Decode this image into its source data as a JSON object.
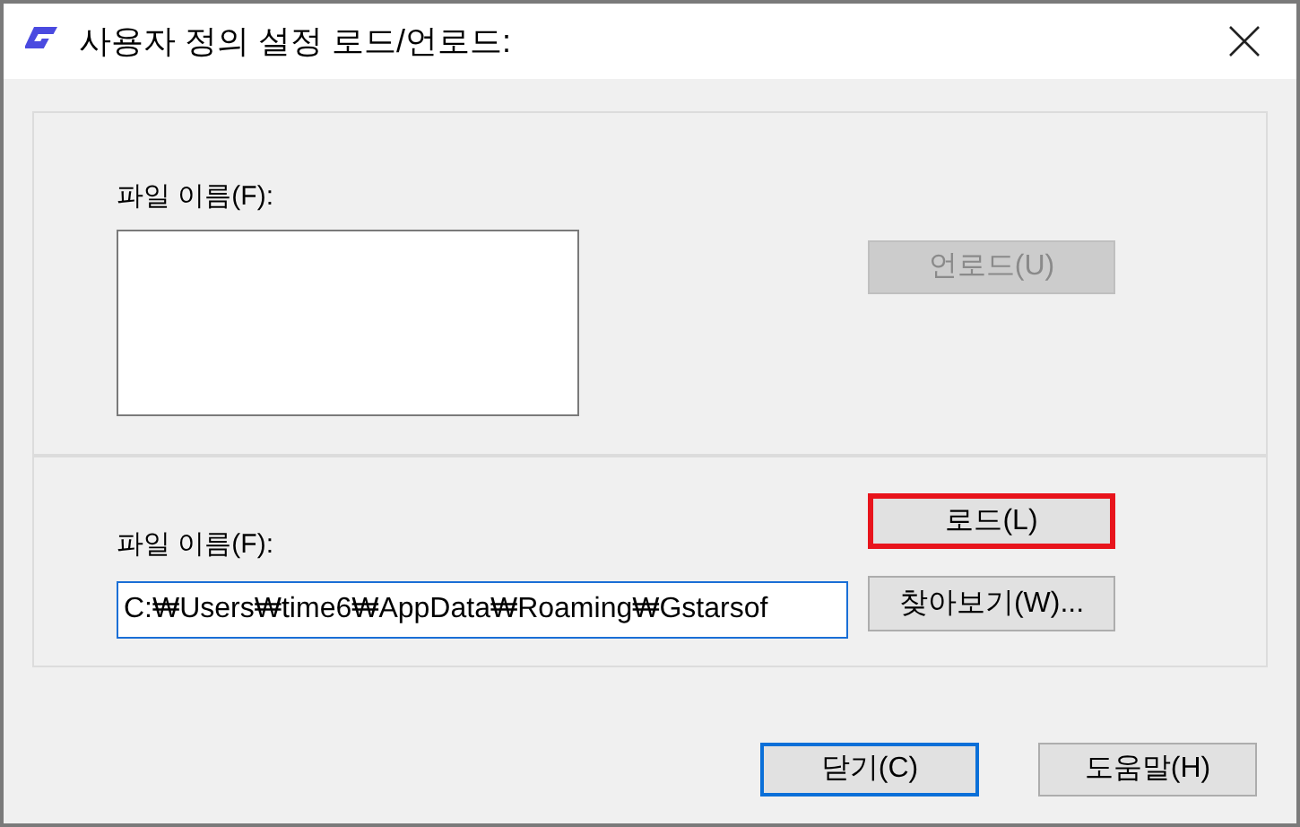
{
  "window": {
    "title": "사용자 정의 설정 로드/언로드:"
  },
  "unload_section": {
    "label": "파일 이름(F):",
    "button": {
      "label": "언로드(U)",
      "disabled": true
    }
  },
  "load_section": {
    "label": "파일 이름(F):",
    "file_field": {
      "value": "C:₩Users₩time6₩AppData₩Roaming₩Gstarsof"
    },
    "buttons": [
      {
        "label": "로드(L)",
        "highlighted": true
      },
      {
        "label": "찾아보기(W)...",
        "highlighted": false
      }
    ]
  },
  "footer_buttons": [
    {
      "label": "닫기(C)",
      "focused": true
    },
    {
      "label": "도움말(H)",
      "focused": false
    }
  ]
}
